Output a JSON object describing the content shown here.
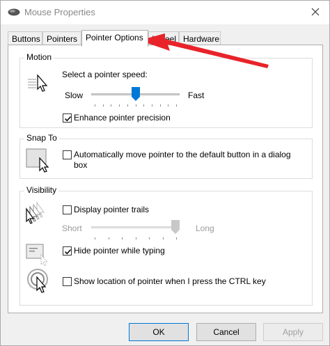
{
  "window": {
    "title": "Mouse Properties"
  },
  "tabs": [
    {
      "label": "Buttons"
    },
    {
      "label": "Pointers"
    },
    {
      "label": "Pointer Options",
      "active": true
    },
    {
      "label": "Wheel"
    },
    {
      "label": "Hardware"
    }
  ],
  "motion": {
    "group_label": "Motion",
    "speed_label": "Select a pointer speed:",
    "slow_label": "Slow",
    "fast_label": "Fast",
    "speed_level": 0.5,
    "enhance_label": "Enhance pointer precision",
    "enhance_checked": true
  },
  "snap_to": {
    "group_label": "Snap To",
    "auto_label_line1": "Automatically move pointer to the default button in a dialog",
    "auto_label_line2": "box",
    "auto_checked": false
  },
  "visibility": {
    "group_label": "Visibility",
    "trails_label": "Display pointer trails",
    "trails_checked": false,
    "short_label": "Short",
    "long_label": "Long",
    "trails_level": 1.0,
    "hide_label": "Hide pointer while typing",
    "hide_checked": true,
    "show_ctrl_label": "Show location of pointer when I press the CTRL key",
    "show_ctrl_checked": false
  },
  "buttons": {
    "ok": "OK",
    "cancel": "Cancel",
    "apply": "Apply"
  },
  "colors": {
    "accent": "#0078d7",
    "annotation_arrow": "#e8232a"
  },
  "icons": {
    "app": "mouse-icon",
    "close": "close-icon"
  }
}
